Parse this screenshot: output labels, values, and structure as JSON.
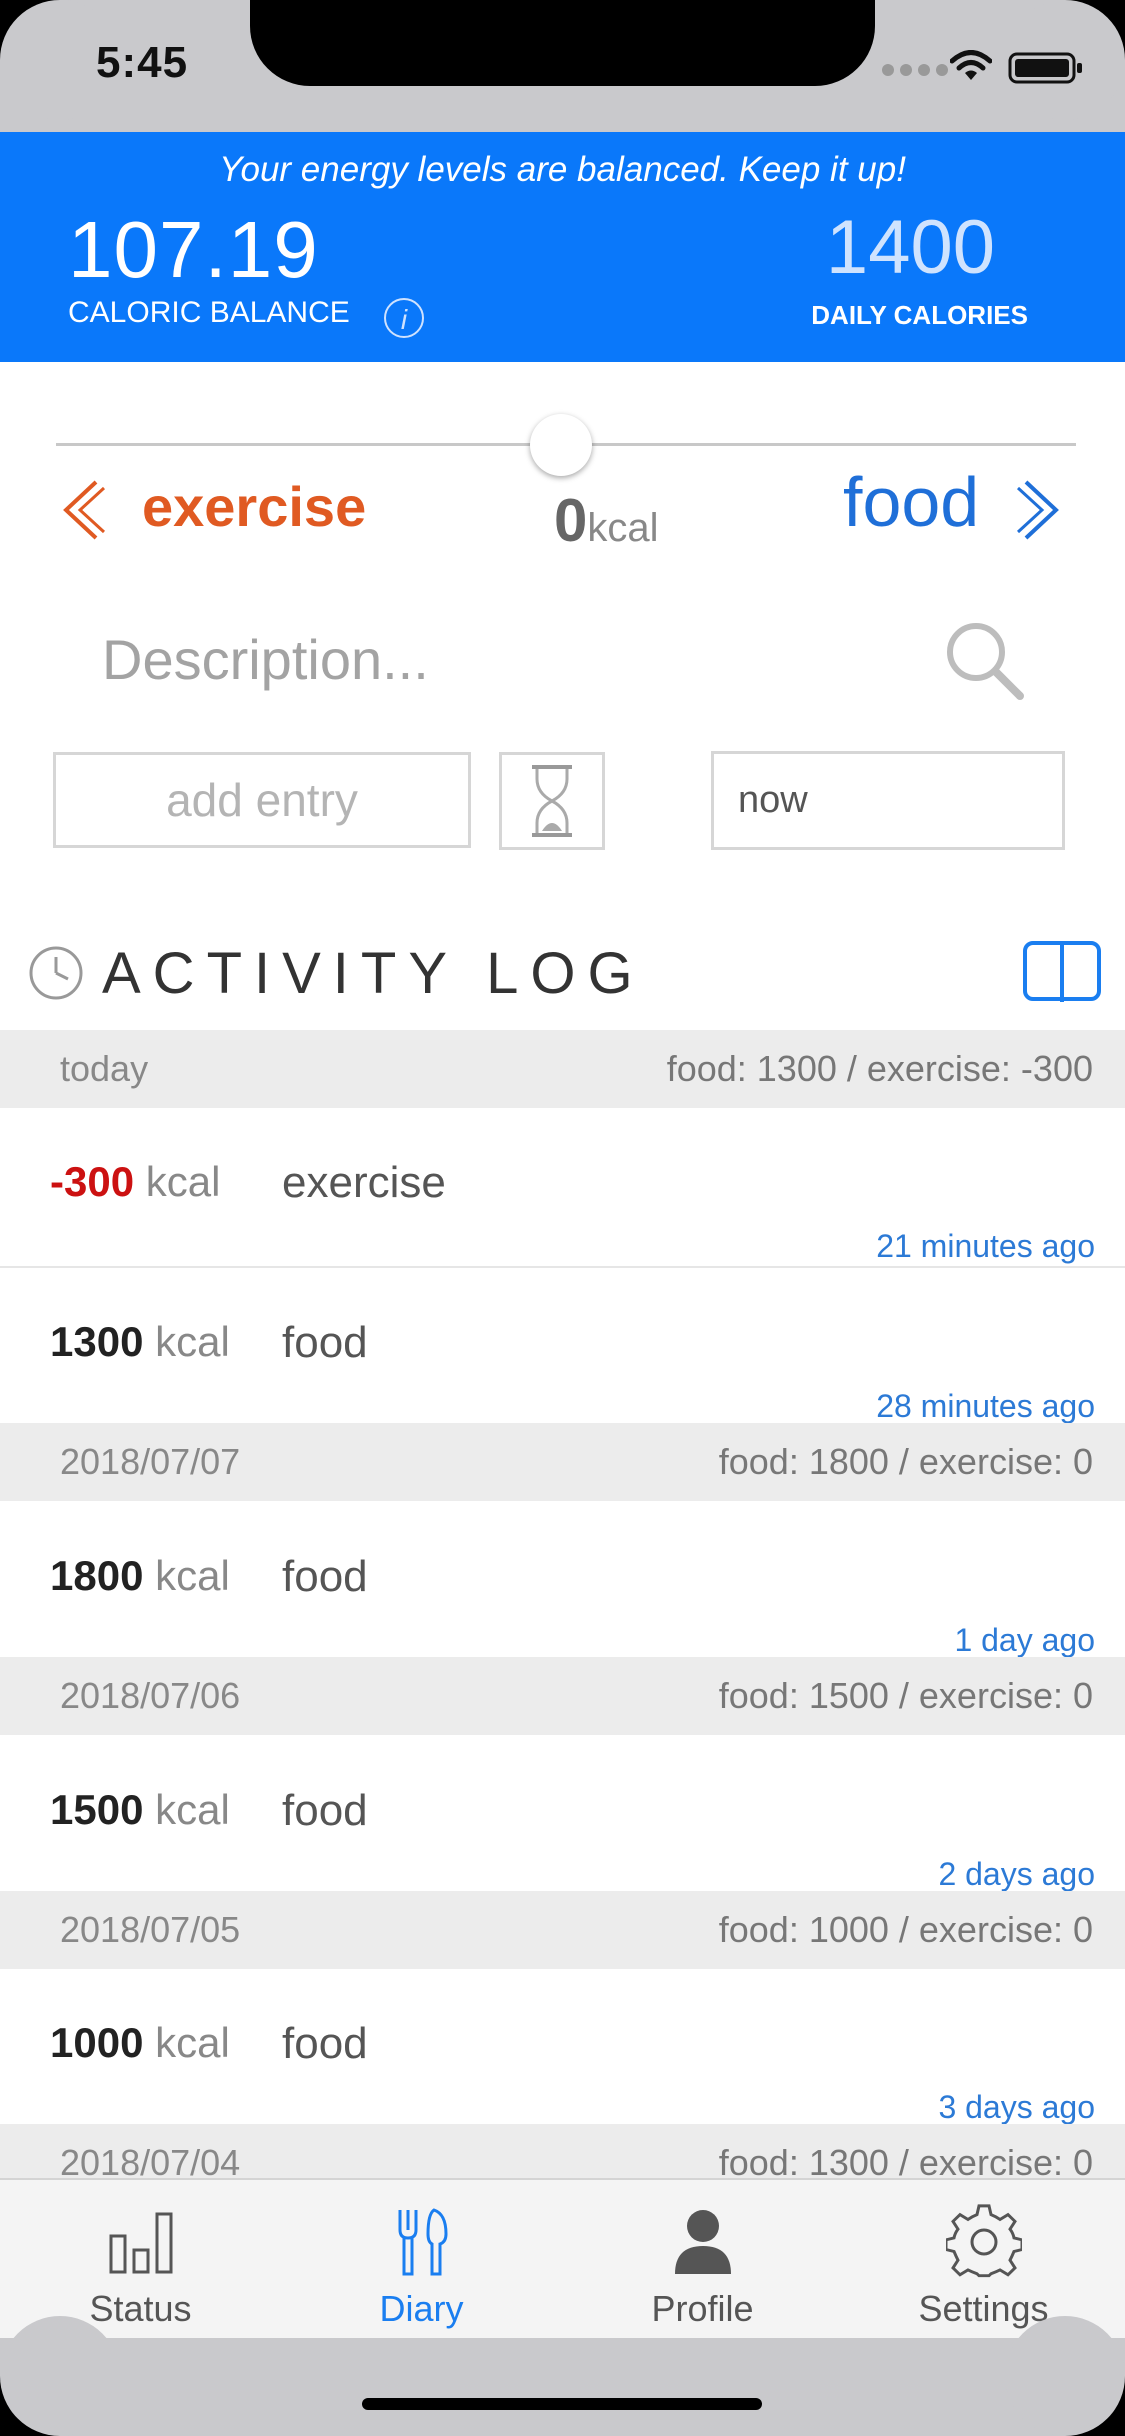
{
  "status_bar": {
    "time": "5:45"
  },
  "banner": {
    "message": "Your energy levels are balanced. Keep it up!",
    "caloric_balance_value": "107.19",
    "caloric_balance_label": "CALORIC BALANCE",
    "info_glyph": "i",
    "daily_calories_value": "1400",
    "daily_calories_label": "DAILY CALORIES",
    "color": "#0a78fa"
  },
  "slider": {
    "left_label": "exercise",
    "right_label": "food",
    "value": "0",
    "unit": "kcal",
    "position_fraction": 0.5
  },
  "entry_form": {
    "description_placeholder": "Description...",
    "add_entry_label": "add entry",
    "time_value": "now"
  },
  "activity_log": {
    "title": "ACTIVITY LOG",
    "days": [
      {
        "date": "today",
        "summary": "food: 1300 / exercise: -300"
      },
      {
        "date": "2018/07/07",
        "summary": "food: 1800 / exercise: 0"
      },
      {
        "date": "2018/07/06",
        "summary": "food: 1500 / exercise: 0"
      },
      {
        "date": "2018/07/05",
        "summary": "food: 1000 / exercise: 0"
      },
      {
        "date": "2018/07/04",
        "summary": "food: 1300 / exercise: 0"
      }
    ],
    "entries": [
      {
        "kcal": "-300",
        "unit": "kcal",
        "category": "exercise",
        "ago": "21 minutes ago"
      },
      {
        "kcal": "1300",
        "unit": "kcal",
        "category": "food",
        "ago": "28 minutes ago"
      },
      {
        "kcal": "1800",
        "unit": "kcal",
        "category": "food",
        "ago": "1 day ago"
      },
      {
        "kcal": "1500",
        "unit": "kcal",
        "category": "food",
        "ago": "2 days ago"
      },
      {
        "kcal": "1000",
        "unit": "kcal",
        "category": "food",
        "ago": "3 days ago"
      }
    ]
  },
  "tab_bar": {
    "tabs": [
      {
        "label": "Status",
        "icon": "bar-chart-icon"
      },
      {
        "label": "Diary",
        "icon": "fork-knife-icon"
      },
      {
        "label": "Profile",
        "icon": "person-icon"
      },
      {
        "label": "Settings",
        "icon": "gear-icon"
      }
    ],
    "active_color": "#1a7ef0"
  }
}
